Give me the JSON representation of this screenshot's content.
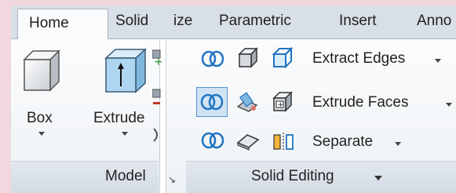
{
  "tabs": {
    "home": "Home",
    "solid": "Solid",
    "visualize_frag": "ize",
    "parametric": "Parametric",
    "insert": "Insert",
    "anno_frag": "Anno"
  },
  "model_panel": {
    "box_label": "Box",
    "extrude_label": "Extrude",
    "footer_label": "Model",
    "footer_icon": "dialog-launcher-icon"
  },
  "solid_editing_panel": {
    "extract_edges": "Extract Edges",
    "extrude_faces": "Extrude Faces",
    "separate": "Separate",
    "footer_label": "Solid Editing"
  },
  "colors": {
    "ribbon_bg": "#fbfcfd",
    "tab_bar": "#d8dfe6",
    "icon_blue": "#1f74c2",
    "selected_bg": "#cfe3f5",
    "page_bg": "#f0d8de"
  }
}
